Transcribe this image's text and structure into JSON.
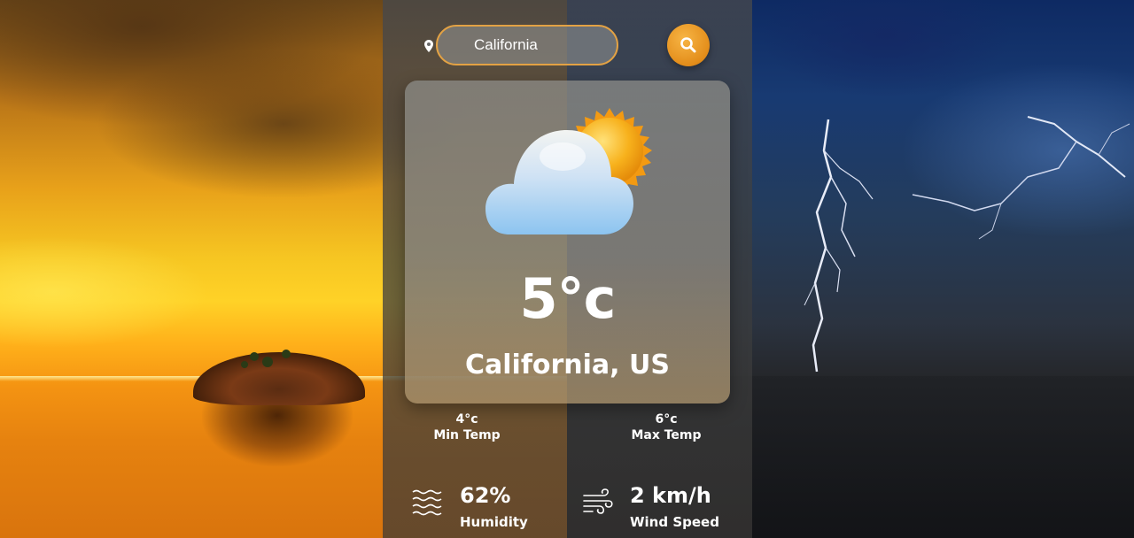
{
  "search": {
    "value": "California",
    "placeholder": ""
  },
  "current": {
    "temperature": "5°c",
    "location": "California, US"
  },
  "temps": {
    "min_value": "4°c",
    "min_label": "Min Temp",
    "max_value": "6°c",
    "max_label": "Max Temp"
  },
  "metrics": {
    "humidity_value": "62%",
    "humidity_label": "Humidity",
    "wind_value": "2 km/h",
    "wind_label": "Wind Speed"
  },
  "colors": {
    "accent": "#e38d1a",
    "field_border": "#e3a244",
    "text": "#ffffff"
  },
  "icons": {
    "location": "location-pin-icon",
    "search": "search-icon",
    "weather": "partly-cloudy-icon",
    "humidity": "humidity-waves-icon",
    "wind": "wind-icon"
  }
}
